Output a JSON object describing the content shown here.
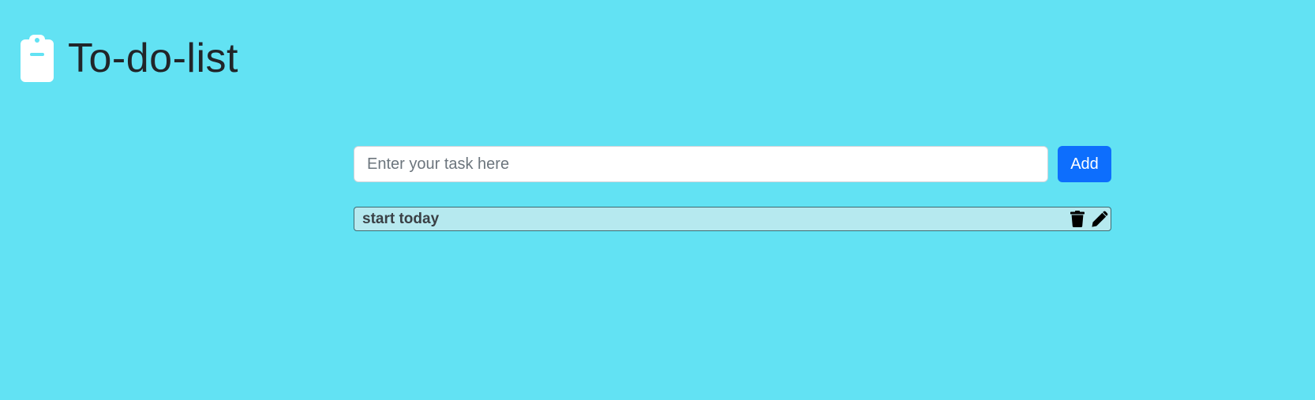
{
  "header": {
    "title": "To-do-list",
    "icon": "clipboard-icon"
  },
  "add_form": {
    "placeholder": "Enter your task here",
    "value": "",
    "add_label": "Add"
  },
  "tasks": [
    {
      "text": "start today",
      "delete_icon": "trash-icon",
      "edit_icon": "pencil-icon"
    }
  ],
  "colors": {
    "background": "#62e2f3",
    "add_button": "#0d6efd",
    "task_background": "#b6e9ef"
  }
}
